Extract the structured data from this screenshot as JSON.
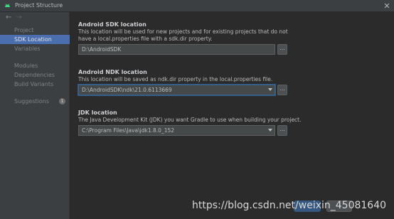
{
  "window": {
    "title": "Project Structure"
  },
  "sidebar": {
    "items": [
      {
        "label": "Project"
      },
      {
        "label": "SDK Location"
      },
      {
        "label": "Variables"
      },
      {
        "label": "Modules"
      },
      {
        "label": "Dependencies"
      },
      {
        "label": "Build Variants"
      },
      {
        "label": "Suggestions",
        "badge": "1"
      }
    ]
  },
  "sdk": {
    "title": "Android SDK location",
    "description": "This location will be used for new projects and for existing projects that do not have a local.properties file with a sdk.dir property.",
    "value": "D:\\AndroidSDK",
    "browse_label": "..."
  },
  "ndk": {
    "title": "Android NDK location",
    "description": "This location will be saved as ndk.dir property in the local.properties file.",
    "value": "D:\\AndroidSDK\\ndk\\21.0.6113669",
    "browse_label": "..."
  },
  "jdk": {
    "title": "JDK location",
    "description": "The Java Development Kit (JDK) you want Gradle to use when building your project.",
    "value": "C:\\Program Files\\Java\\jdk1.8.0_152",
    "browse_label": "..."
  },
  "watermark": "https://blog.csdn.net/weixin_45081640",
  "colors": {
    "accent": "#4b6eaf",
    "background": "#2b2b2b",
    "panel": "#3c3f41"
  }
}
